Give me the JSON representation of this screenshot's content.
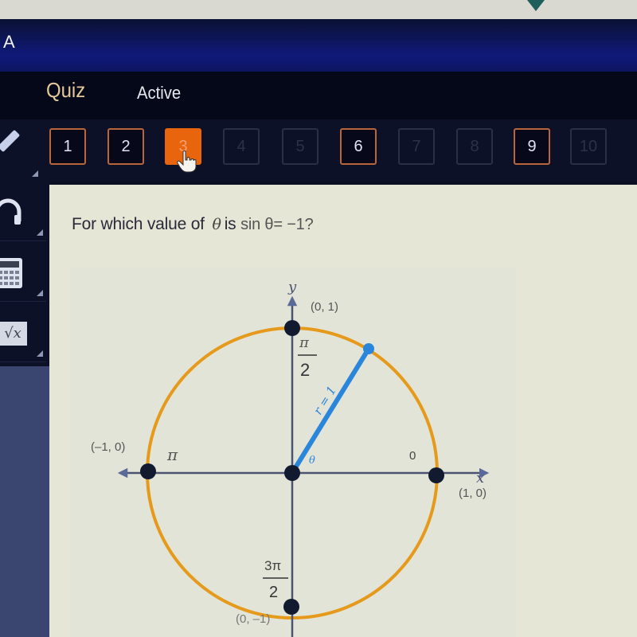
{
  "app": {
    "header_letter": "A",
    "nav": {
      "section": "Quiz",
      "status": "Active"
    }
  },
  "question_nav": {
    "buttons": [
      {
        "label": "1",
        "state": "answered"
      },
      {
        "label": "2",
        "state": "answered"
      },
      {
        "label": "3",
        "state": "current"
      },
      {
        "label": "4",
        "state": "disabled"
      },
      {
        "label": "5",
        "state": "disabled"
      },
      {
        "label": "6",
        "state": "answered"
      },
      {
        "label": "7",
        "state": "disabled"
      },
      {
        "label": "8",
        "state": "disabled"
      },
      {
        "label": "9",
        "state": "answered"
      },
      {
        "label": "10",
        "state": "disabled"
      }
    ]
  },
  "sidebar": {
    "tools": [
      {
        "name": "pencil",
        "icon": "pencil-icon"
      },
      {
        "name": "headphones",
        "icon": "headphones-icon"
      },
      {
        "name": "calculator",
        "icon": "calculator-icon"
      },
      {
        "name": "formula",
        "icon": "sqrt-icon",
        "label": "√x"
      }
    ]
  },
  "question": {
    "prefix": "For which value of",
    "variable": "θ",
    "middle": "is",
    "expression": "sin θ= −1?"
  },
  "diagram": {
    "axis_x_label": "x",
    "axis_y_label": "y",
    "points": [
      {
        "coord": "(0, 1)",
        "angle": "π/2",
        "angle_num": "π",
        "angle_den": "2"
      },
      {
        "coord": "(1, 0)",
        "angle": "0"
      },
      {
        "coord": "(–1, 0)",
        "angle": "π"
      },
      {
        "coord": "(0, –1)",
        "angle": "3π/2",
        "angle_num": "3π",
        "angle_den": "2"
      }
    ],
    "radius_label": "r = 1",
    "theta_label": "θ",
    "colors": {
      "circle": "#e59a1c",
      "radius": "#2a86db",
      "axes": "#4a5370",
      "points": "#111a2e"
    }
  }
}
